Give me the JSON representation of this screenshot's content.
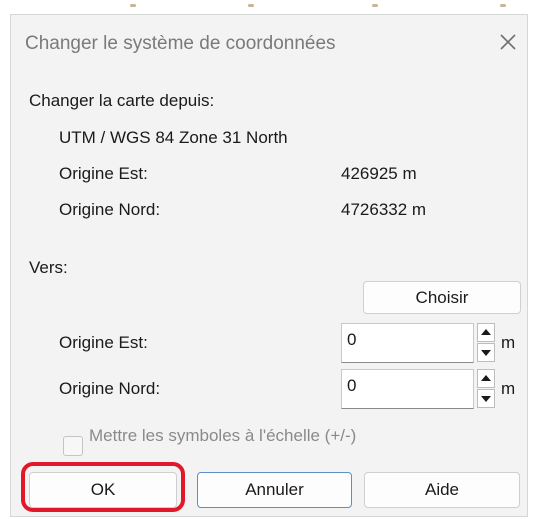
{
  "dialog": {
    "title": "Changer le système de coordonnées"
  },
  "from": {
    "heading": "Changer la carte depuis:",
    "system": "UTM / WGS 84  Zone 31 North",
    "east_label": "Origine Est:",
    "east_value": "426925 m",
    "north_label": "Origine Nord:",
    "north_value": "4726332 m"
  },
  "to": {
    "heading": "Vers:",
    "choose_label": "Choisir",
    "east_label": "Origine Est:",
    "east_value": "0",
    "east_unit": "m",
    "north_label": "Origine Nord:",
    "north_value": "0",
    "north_unit": "m"
  },
  "scale_symbols": {
    "label": "Mettre les symboles à l'échelle (+/-)",
    "checked": false
  },
  "buttons": {
    "ok": "OK",
    "cancel": "Annuler",
    "help": "Aide"
  },
  "colors": {
    "dialog_bg": "#f3f3f3",
    "highlight": "#e0182a",
    "disabled_text": "#8a8a8a"
  },
  "icons": {
    "close": "close-icon",
    "spin_up": "chevron-up-icon",
    "spin_down": "chevron-down-icon"
  }
}
